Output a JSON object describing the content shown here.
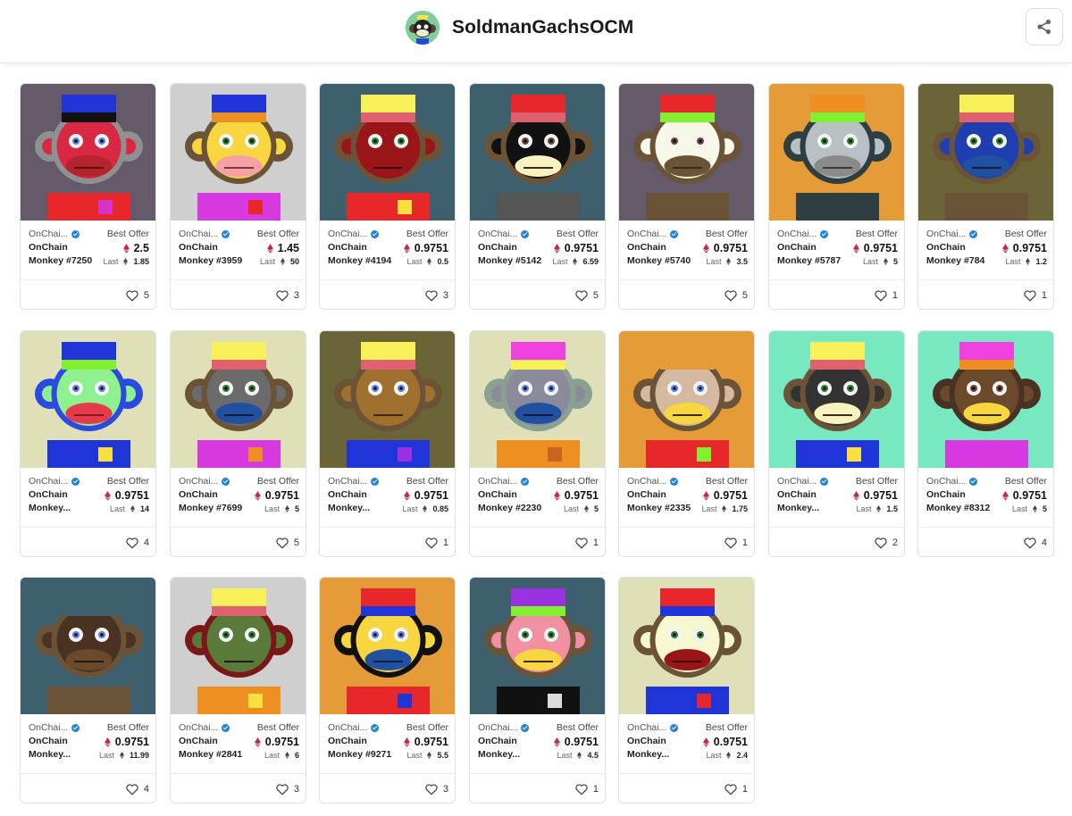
{
  "header": {
    "title": "SoldmanGachsOCM",
    "share_icon": "share-icon"
  },
  "labels": {
    "best_offer": "Best Offer",
    "last": "Last"
  },
  "cards": [
    {
      "collection": "OnChai...",
      "name": "OnChain Monkey #7250",
      "price": "2.5",
      "last": "1.85",
      "likes": "5",
      "eth_color": "#c0285b",
      "art": {
        "bg": "#645a6a",
        "fur": "#8d9190",
        "face": "#d82843",
        "muzzle": "#b3242d",
        "eye": "#5f7fe8",
        "mouth": "#5a1010",
        "hat_top": "#1f35d8",
        "hat_band": "#111111",
        "shirt": "#e8272a",
        "badge": "#d830c8"
      }
    },
    {
      "collection": "OnChai...",
      "name": "OnChain Monkey #3959",
      "price": "1.45",
      "last": "50",
      "likes": "3",
      "eth_color": "#c0285b",
      "art": {
        "bg": "#cfcfcf",
        "fur": "#6a5336",
        "face": "#f8d640",
        "muzzle": "#f59fa7",
        "eye": "#2f7f2f",
        "mouth": "#7a3a3a",
        "hat_top": "#1f35d8",
        "hat_band": "#ee8f22",
        "shirt": "#d838e0",
        "badge": "#e8272a"
      }
    },
    {
      "collection": "OnChai...",
      "name": "OnChain Monkey #4194",
      "price": "0.9751",
      "last": "0.5",
      "likes": "3",
      "eth_color": "#c0285b",
      "art": {
        "bg": "#3d5f6e",
        "fur": "#6a5336",
        "face": "#9a1518",
        "muzzle": "#9a1518",
        "eye": "#2f7f2f",
        "mouth": "#3a0a0a",
        "hat_top": "#f8f058",
        "hat_band": "#e06070",
        "shirt": "#e8272a",
        "badge": "#f8e040"
      }
    },
    {
      "collection": "OnChai...",
      "name": "OnChain Monkey #5142",
      "price": "0.9751",
      "last": "6.59",
      "likes": "5",
      "eth_color": "#c0285b",
      "art": {
        "bg": "#3d5f6e",
        "fur": "#6a5336",
        "face": "#111111",
        "muzzle": "#f8f2c0",
        "eye": "#6b4a30",
        "mouth": "#3a2a1a",
        "hat_top": "#e8272a",
        "hat_band": "#e06070",
        "shirt": "#555555",
        "badge": "#555555"
      }
    },
    {
      "collection": "OnChai...",
      "name": "OnChain Monkey #5740",
      "price": "0.9751",
      "last": "3.5",
      "likes": "5",
      "eth_color": "#c0285b",
      "art": {
        "bg": "#645a6a",
        "fur": "#6a5336",
        "face": "#f8f8e8",
        "muzzle": "#6a5336",
        "eye": "#6b4a30",
        "mouth": "#3a2a1a",
        "hat_top": "#e8272a",
        "hat_band": "#80f030",
        "shirt": "#6a5336",
        "badge": "#6a5336"
      }
    },
    {
      "collection": "OnChai...",
      "name": "OnChain Monkey #5787",
      "price": "0.9751",
      "last": "5",
      "likes": "1",
      "eth_color": "#c0285b",
      "art": {
        "bg": "#e59c38",
        "fur": "#2f3e40",
        "face": "#b8c0c4",
        "muzzle": "#8a8a8a",
        "eye": "#2f7f2f",
        "mouth": "#3a3a3a",
        "hat_top": "#ee8f22",
        "hat_band": "#80f030",
        "shirt": "#2f3e40",
        "badge": "#2f3e40"
      }
    },
    {
      "collection": "OnChai...",
      "name": "OnChain Monkey #784",
      "price": "0.9751",
      "last": "1.2",
      "likes": "1",
      "eth_color": "#c0285b",
      "art": {
        "bg": "#6b6436",
        "fur": "#6a5336",
        "face": "#1f3eb0",
        "muzzle": "#2050a0",
        "eye": "#2f7f2f",
        "mouth": "#1a1a3a",
        "hat_top": "#f8f058",
        "hat_band": "#e06070",
        "shirt": "#6a5336",
        "badge": "#6a5336"
      }
    },
    {
      "collection": "OnChai...",
      "name": "OnChain Monkey...",
      "price": "0.9751",
      "last": "14",
      "likes": "4",
      "eth_color": "#c0285b",
      "art": {
        "bg": "#dfdfb8",
        "fur": "#2a4ae0",
        "face": "#8ef08e",
        "muzzle": "#e63a4a",
        "eye": "#5f7fe8",
        "mouth": "#8a1a1a",
        "hat_top": "#1f35d8",
        "hat_band": "#80f030",
        "shirt": "#1f35d8",
        "badge": "#f8e040"
      }
    },
    {
      "collection": "OnChai...",
      "name": "OnChain Monkey #7699",
      "price": "0.9751",
      "last": "5",
      "likes": "5",
      "eth_color": "#c0285b",
      "art": {
        "bg": "#dfdfb8",
        "fur": "#6a5336",
        "face": "#6b6b6b",
        "muzzle": "#2050a0",
        "eye": "#2f7f2f",
        "mouth": "#1a1a3a",
        "hat_top": "#f8f058",
        "hat_band": "#e06070",
        "shirt": "#d838e0",
        "badge": "#ee8f22"
      }
    },
    {
      "collection": "OnChai...",
      "name": "OnChain Monkey...",
      "price": "0.9751",
      "last": "0.85",
      "likes": "1",
      "eth_color": "#c0285b",
      "art": {
        "bg": "#6b6436",
        "fur": "#6a5336",
        "face": "#a0702e",
        "muzzle": "#a0702e",
        "eye": "#5f7fe8",
        "mouth": "#3a2a1a",
        "hat_top": "#f8f058",
        "hat_band": "#e06070",
        "shirt": "#1f35d8",
        "badge": "#9a30e0"
      }
    },
    {
      "collection": "OnChai...",
      "name": "OnChain Monkey #2230",
      "price": "0.9751",
      "last": "5",
      "likes": "1",
      "eth_color": "#c0285b",
      "art": {
        "bg": "#dfdfb8",
        "fur": "#8aa090",
        "face": "#8a8a9a",
        "muzzle": "#2050a0",
        "eye": "#5f7fe8",
        "mouth": "#1a1a3a",
        "hat_top": "#f040e0",
        "hat_band": "#f8f058",
        "shirt": "#ee8f22",
        "badge": "#c86420"
      }
    },
    {
      "collection": "OnChai...",
      "name": "OnChain Monkey #2335",
      "price": "0.9751",
      "last": "1.75",
      "likes": "1",
      "eth_color": "#c0285b",
      "art": {
        "bg": "#e59c38",
        "fur": "#6a5336",
        "face": "#d4b8a0",
        "muzzle": "#f8d640",
        "eye": "#5f7fe8",
        "mouth": "#3a2a1a",
        "hat_top": "#e59c38",
        "hat_band": "#e59c38",
        "shirt": "#e8272a",
        "badge": "#80f030"
      }
    },
    {
      "collection": "OnChai...",
      "name": "OnChain Monkey...",
      "price": "0.9751",
      "last": "1.5",
      "likes": "2",
      "eth_color": "#c0285b",
      "art": {
        "bg": "#78e8c0",
        "fur": "#6a5336",
        "face": "#333333",
        "muzzle": "#f8f2c0",
        "eye": "#2f7f2f",
        "mouth": "#3a2a1a",
        "hat_top": "#f8f058",
        "hat_band": "#e06070",
        "shirt": "#1f35d8",
        "badge": "#f8e040"
      }
    },
    {
      "collection": "OnChai...",
      "name": "OnChain Monkey #8312",
      "price": "0.9751",
      "last": "5",
      "likes": "4",
      "eth_color": "#c0285b",
      "art": {
        "bg": "#78e8c0",
        "fur": "#4a3222",
        "face": "#6a4a2a",
        "muzzle": "#f8d640",
        "eye": "#6b4a30",
        "mouth": "#3a2a1a",
        "hat_top": "#f040e0",
        "hat_band": "#ee8f22",
        "shirt": "#d838e0",
        "badge": "#d838e0"
      }
    },
    {
      "collection": "OnChai...",
      "name": "OnChain Monkey...",
      "price": "0.9751",
      "last": "11.99",
      "likes": "4",
      "eth_color": "#c0285b",
      "art": {
        "bg": "#3d5f6e",
        "fur": "#6a5336",
        "face": "#4a3222",
        "muzzle": "#6a4a2a",
        "eye": "#5f7fe8",
        "mouth": "#1a1a1a",
        "hat_top": "#3d5f6e",
        "hat_band": "#3d5f6e",
        "shirt": "#6a5336",
        "badge": "#6a5336"
      }
    },
    {
      "collection": "OnChai...",
      "name": "OnChain Monkey #2841",
      "price": "0.9751",
      "last": "6",
      "likes": "3",
      "eth_color": "#c0285b",
      "art": {
        "bg": "#cfcfcf",
        "fur": "#7a1818",
        "face": "#5a7a3a",
        "muzzle": "#5a7a3a",
        "eye": "#2f7f2f",
        "mouth": "#1a1a1a",
        "hat_top": "#f8f058",
        "hat_band": "#e06070",
        "shirt": "#ee8f22",
        "badge": "#f8e040"
      }
    },
    {
      "collection": "OnChai...",
      "name": "OnChain Monkey #9271",
      "price": "0.9751",
      "last": "5.5",
      "likes": "3",
      "eth_color": "#c0285b",
      "art": {
        "bg": "#e59c38",
        "fur": "#111111",
        "face": "#f8d640",
        "muzzle": "#2050a0",
        "eye": "#5f7fe8",
        "mouth": "#1a1a3a",
        "hat_top": "#e8272a",
        "hat_band": "#1f35d8",
        "shirt": "#e8272a",
        "badge": "#1f35d8"
      }
    },
    {
      "collection": "OnChai...",
      "name": "OnChain Monkey...",
      "price": "0.9751",
      "last": "4.5",
      "likes": "1",
      "eth_color": "#c0285b",
      "art": {
        "bg": "#3d5f6e",
        "fur": "#6a5336",
        "face": "#f090a0",
        "muzzle": "#f8d640",
        "eye": "#2f7f2f",
        "mouth": "#3a2a1a",
        "hat_top": "#9a30e0",
        "hat_band": "#80f030",
        "shirt": "#111111",
        "badge": "#dcdcdc"
      }
    },
    {
      "collection": "OnChai...",
      "name": "OnChain Monkey...",
      "price": "0.9751",
      "last": "2.4",
      "likes": "1",
      "eth_color": "#c0285b",
      "art": {
        "bg": "#dfdfb8",
        "fur": "#6a5336",
        "face": "#f8f8d0",
        "muzzle": "#9a1518",
        "eye": "#2f7f2f",
        "mouth": "#3a0a0a",
        "hat_top": "#e8272a",
        "hat_band": "#1f35d8",
        "shirt": "#1f35d8",
        "badge": "#e8272a"
      }
    }
  ]
}
